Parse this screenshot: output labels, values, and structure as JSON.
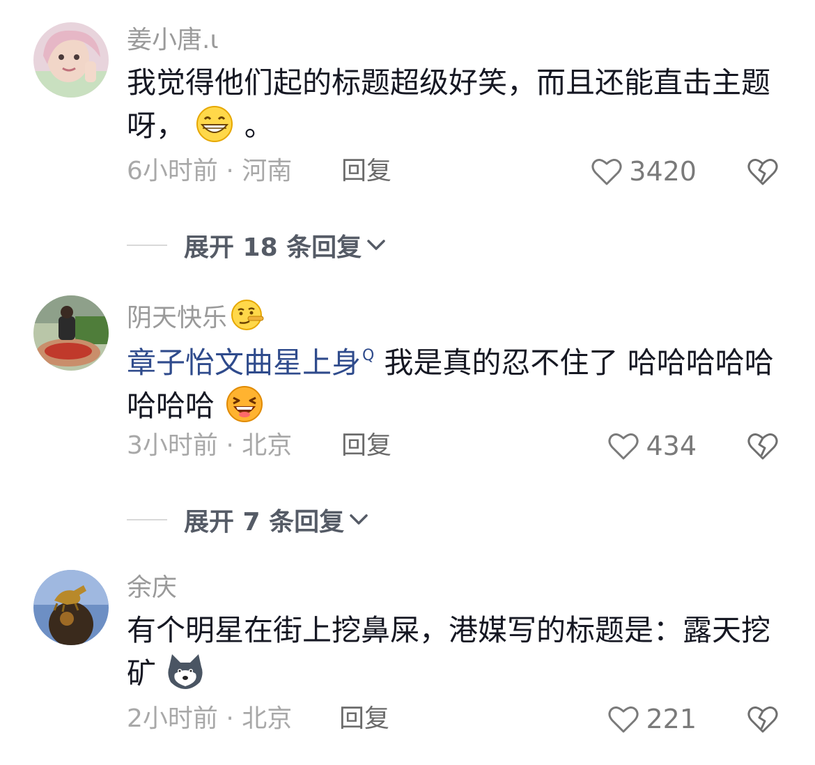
{
  "comments": [
    {
      "username": "姜小唐.ι",
      "text_before": "我觉得他们起的标题超级好笑，而且还能直击主题呀，",
      "text_after": "。",
      "emoji": "grin-emoji",
      "time_location": "6小时前 · 河南",
      "reply_label": "回复",
      "likes": "3420",
      "expand_label": "展开 18 条回复"
    },
    {
      "username": "阴天快乐",
      "username_emoji": "lying-face-emoji",
      "mention": "章子怡文曲星上身",
      "mention_search_mark": "Q",
      "text": "我是真的忍不住了 哈哈哈哈哈哈哈哈",
      "emoji": "laughing-emoji",
      "time_location": "3小时前 · 北京",
      "reply_label": "回复",
      "likes": "434",
      "expand_label": "展开 7 条回复"
    },
    {
      "username": "余庆",
      "text": "有个明星在街上挖鼻屎，港媒写的标题是：露天挖矿",
      "emoji": "doge-emoji",
      "time_location": "2小时前 · 北京",
      "reply_label": "回复",
      "likes": "221"
    }
  ],
  "colors": {
    "text": "#161823",
    "meta": "#a8a8a8",
    "mention": "#2f4b8c"
  }
}
